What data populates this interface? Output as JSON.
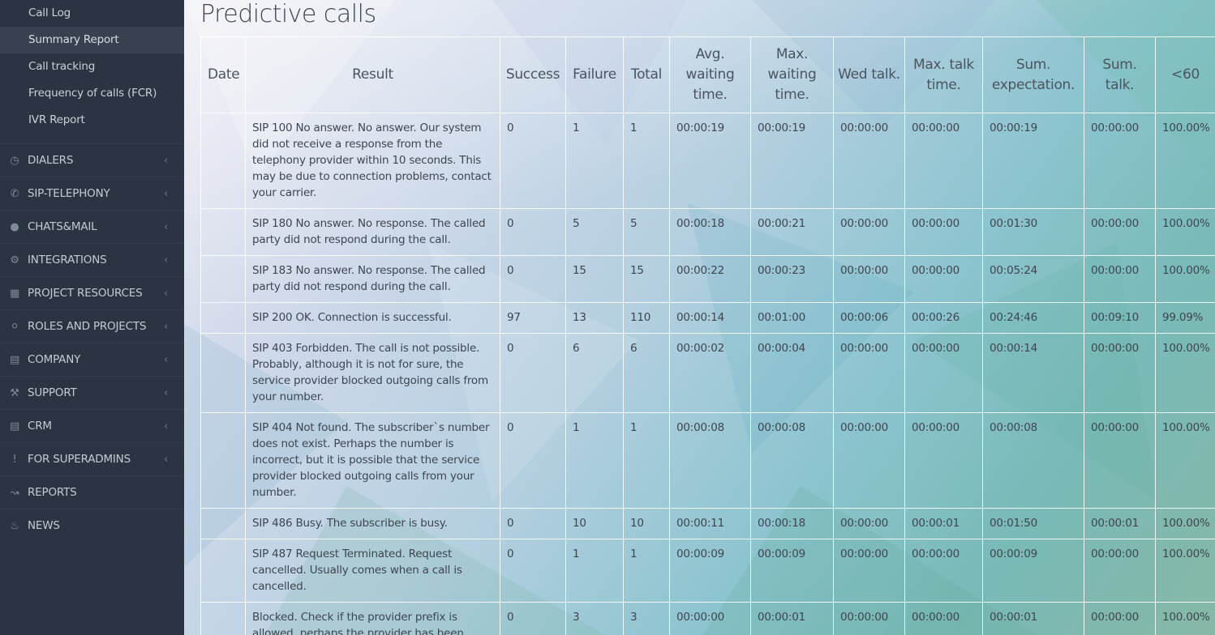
{
  "sidebar": {
    "sub_items": [
      {
        "label": "Call Log"
      },
      {
        "label": "Summary Report"
      },
      {
        "label": "Call tracking"
      },
      {
        "label": "Frequency of calls (FCR)"
      },
      {
        "label": "IVR Report"
      }
    ],
    "nav_items": [
      {
        "label": "DIALERS",
        "icon": "clock-icon"
      },
      {
        "label": "SIP-TELEPHONY",
        "icon": "phone-icon"
      },
      {
        "label": "CHATS&MAIL",
        "icon": "chat-icon"
      },
      {
        "label": "INTEGRATIONS",
        "icon": "gears-icon"
      },
      {
        "label": "PROJECT RESOURCES",
        "icon": "grid-icon"
      },
      {
        "label": "ROLES AND PROJECTS",
        "icon": "toggle-icon"
      },
      {
        "label": "COMPANY",
        "icon": "bar-chart-icon"
      },
      {
        "label": "SUPPORT",
        "icon": "wrench-icon"
      },
      {
        "label": "CRM",
        "icon": "list-icon"
      },
      {
        "label": "FOR SUPERADMINS",
        "icon": "exclamation-icon"
      },
      {
        "label": "REPORTS",
        "icon": "line-chart-icon"
      },
      {
        "label": "NEWS",
        "icon": "bell-icon"
      }
    ]
  },
  "main": {
    "title": "Predictive calls",
    "columns": [
      "Date",
      "Result",
      "Success",
      "Failure",
      "Total",
      "Avg. waiting time.",
      "Max. waiting time.",
      "Wed talk.",
      "Max. talk time.",
      "Sum. expectation.",
      "Sum. talk.",
      "<60"
    ],
    "rows": [
      {
        "date": "",
        "result": "SIP 100 No answer. No answer. Our system did not receive a response from the telephony provider within 10 seconds. This may be due to connection problems, contact your carrier.",
        "success": "0",
        "failure": "1",
        "total": "1",
        "avg_wait": "00:00:19",
        "max_wait": "00:00:19",
        "wed_talk": "00:00:00",
        "max_talk": "00:00:00",
        "sum_exp": "00:00:19",
        "sum_talk": "00:00:00",
        "lt60": "100.00%"
      },
      {
        "date": "",
        "result": "SIP 180 No answer. No response. The called party did not respond during the call.",
        "success": "0",
        "failure": "5",
        "total": "5",
        "avg_wait": "00:00:18",
        "max_wait": "00:00:21",
        "wed_talk": "00:00:00",
        "max_talk": "00:00:00",
        "sum_exp": "00:01:30",
        "sum_talk": "00:00:00",
        "lt60": "100.00%"
      },
      {
        "date": "",
        "result": "SIP 183 No answer. No response. The called party did not respond during the call.",
        "success": "0",
        "failure": "15",
        "total": "15",
        "avg_wait": "00:00:22",
        "max_wait": "00:00:23",
        "wed_talk": "00:00:00",
        "max_talk": "00:00:00",
        "sum_exp": "00:05:24",
        "sum_talk": "00:00:00",
        "lt60": "100.00%"
      },
      {
        "date": "",
        "result": "SIP 200 OK. Connection is successful.",
        "success": "97",
        "failure": "13",
        "total": "110",
        "avg_wait": "00:00:14",
        "max_wait": "00:01:00",
        "wed_talk": "00:00:06",
        "max_talk": "00:00:26",
        "sum_exp": "00:24:46",
        "sum_talk": "00:09:10",
        "lt60": "99.09%"
      },
      {
        "date": "",
        "result": "SIP 403 Forbidden. The call is not possible. Probably, although it is not for sure, the service provider blocked outgoing calls from your number.",
        "success": "0",
        "failure": "6",
        "total": "6",
        "avg_wait": "00:00:02",
        "max_wait": "00:00:04",
        "wed_talk": "00:00:00",
        "max_talk": "00:00:00",
        "sum_exp": "00:00:14",
        "sum_talk": "00:00:00",
        "lt60": "100.00%"
      },
      {
        "date": "",
        "result": "SIP 404 Not found. The subscriber`s number does not exist. Perhaps the number is incorrect, but it is possible that the service provider blocked outgoing calls from your number.",
        "success": "0",
        "failure": "1",
        "total": "1",
        "avg_wait": "00:00:08",
        "max_wait": "00:00:08",
        "wed_talk": "00:00:00",
        "max_talk": "00:00:00",
        "sum_exp": "00:00:08",
        "sum_talk": "00:00:00",
        "lt60": "100.00%"
      },
      {
        "date": "",
        "result": "SIP 486 Busy. The subscriber is busy.",
        "success": "0",
        "failure": "10",
        "total": "10",
        "avg_wait": "00:00:11",
        "max_wait": "00:00:18",
        "wed_talk": "00:00:00",
        "max_talk": "00:00:01",
        "sum_exp": "00:01:50",
        "sum_talk": "00:00:01",
        "lt60": "100.00%"
      },
      {
        "date": "",
        "result": "SIP 487 Request Terminated. Request cancelled. Usually comes when a call is cancelled.",
        "success": "0",
        "failure": "1",
        "total": "1",
        "avg_wait": "00:00:09",
        "max_wait": "00:00:09",
        "wed_talk": "00:00:00",
        "max_talk": "00:00:00",
        "sum_exp": "00:00:09",
        "sum_talk": "00:00:00",
        "lt60": "100.00%"
      },
      {
        "date": "",
        "result": "Blocked. Check if the provider prefix is allowed, perhaps the provider has been",
        "success": "0",
        "failure": "3",
        "total": "3",
        "avg_wait": "00:00:00",
        "max_wait": "00:00:01",
        "wed_talk": "00:00:00",
        "max_talk": "00:00:00",
        "sum_exp": "00:00:01",
        "sum_talk": "00:00:00",
        "lt60": "100.00%"
      }
    ]
  }
}
